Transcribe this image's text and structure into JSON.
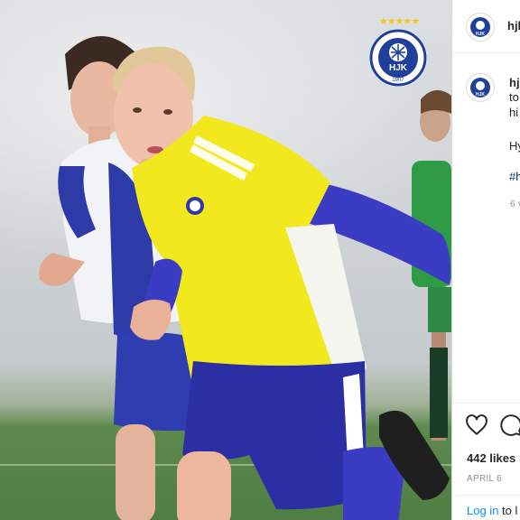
{
  "photo": {
    "scene": "Youth football players in yellow and blue kits running on indoor turf",
    "crest_stars": "★★★★★",
    "crest_year": "1907"
  },
  "post": {
    "username_header": "hjl",
    "username_caption": "hj",
    "caption_line1": "to",
    "caption_line2": "hi",
    "caption_line3": "Hy",
    "hashtag": "#h",
    "time_ago": "6 v",
    "likes": "442 likes",
    "date": "APRIL 6",
    "login_link": "Log in",
    "login_rest": " to l"
  },
  "icons": {
    "like": "heart-icon",
    "comment": "comment-icon"
  },
  "colors": {
    "hjk_blue": "#1f3f9a",
    "kit_yellow": "#f2e81e",
    "link_blue": "#0095f6"
  }
}
